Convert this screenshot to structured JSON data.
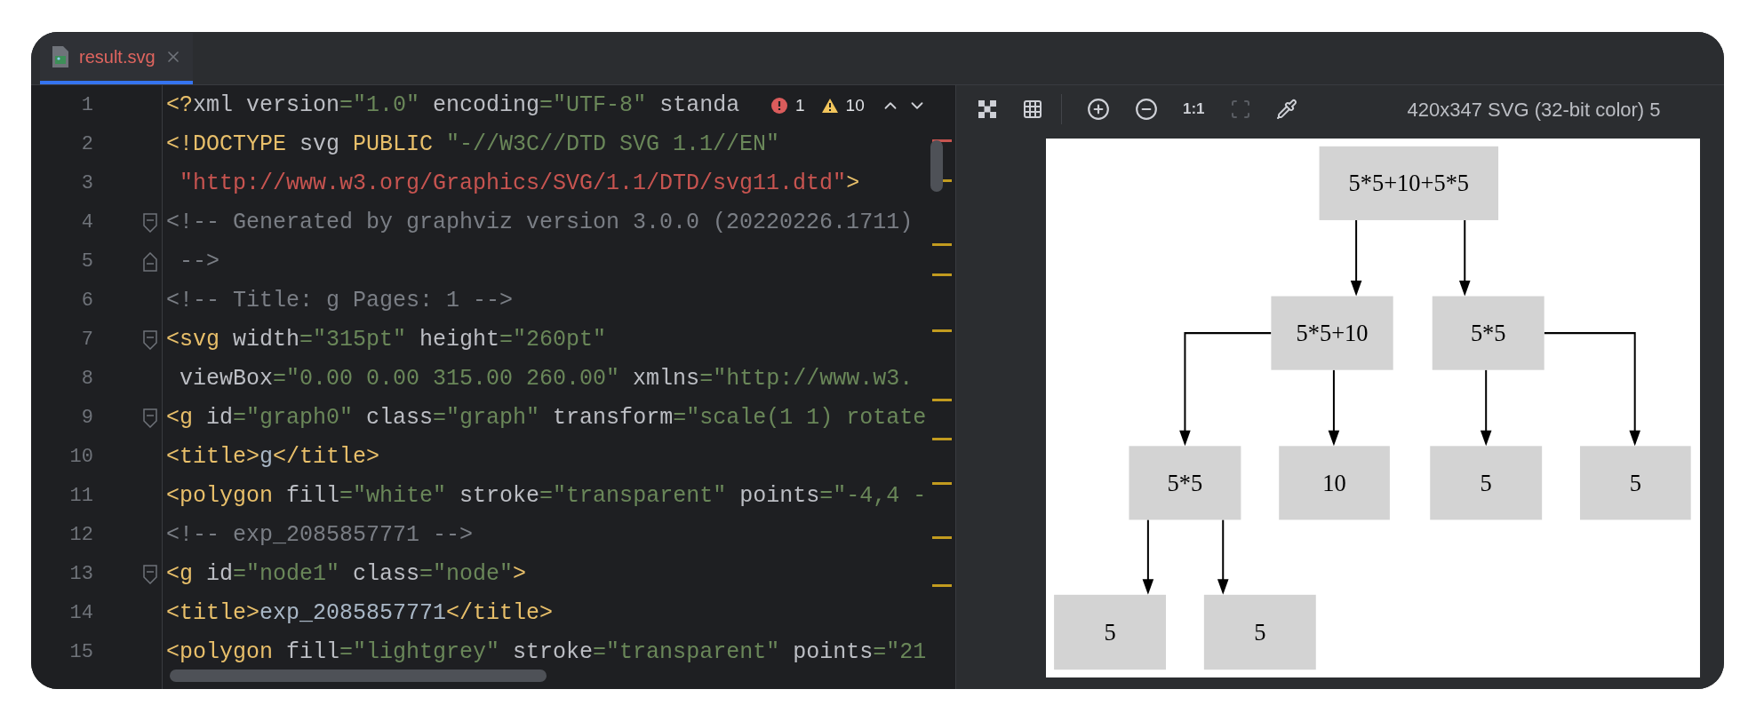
{
  "editor_tabs": [
    {
      "label": "result.svg",
      "selected": true,
      "has_errors": true
    }
  ],
  "code_lines": [
    {
      "number": "1",
      "tokens": [
        {
          "kind": "tag",
          "text": "<?"
        },
        {
          "kind": "plain",
          "text": "xml"
        },
        {
          "kind": "attr",
          "text": " version"
        },
        {
          "kind": "value",
          "text": "=\"1.0\""
        },
        {
          "kind": "attr",
          "text": " encoding"
        },
        {
          "kind": "value",
          "text": "=\"UTF-8\""
        },
        {
          "kind": "attr",
          "text": " standa"
        }
      ]
    },
    {
      "number": "2",
      "tokens": [
        {
          "kind": "tag",
          "text": "<!DOCTYPE"
        },
        {
          "kind": "plain",
          "text": " svg "
        },
        {
          "kind": "tag",
          "text": "PUBLIC"
        },
        {
          "kind": "value",
          "text": " \"-//W3C//DTD SVG 1.1//EN\""
        }
      ]
    },
    {
      "number": "3",
      "tokens": [
        {
          "kind": "url",
          "text": " \"http://www.w3.org/Graphics/SVG/1.1/DTD/svg11.dtd\""
        },
        {
          "kind": "tag",
          "text": ">"
        }
      ]
    },
    {
      "number": "4",
      "fold_start": true,
      "tokens": [
        {
          "kind": "comment",
          "text": "<!-- Generated by graphviz version 3.0.0 (20220226.1711)"
        }
      ]
    },
    {
      "number": "5",
      "fold_end": true,
      "tokens": [
        {
          "kind": "comment",
          "text": " -->"
        }
      ]
    },
    {
      "number": "6",
      "tokens": [
        {
          "kind": "comment",
          "text": "<!-- Title: g Pages: 1 -->"
        }
      ]
    },
    {
      "number": "7",
      "fold_start": true,
      "tokens": [
        {
          "kind": "tag",
          "text": "<svg"
        },
        {
          "kind": "attr",
          "text": " width"
        },
        {
          "kind": "value",
          "text": "=\"315pt\""
        },
        {
          "kind": "attr",
          "text": " height"
        },
        {
          "kind": "value",
          "text": "=\"260pt\""
        }
      ]
    },
    {
      "number": "8",
      "tokens": [
        {
          "kind": "attr",
          "text": " viewBox"
        },
        {
          "kind": "value",
          "text": "=\"0.00 0.00 315.00 260.00\""
        },
        {
          "kind": "attr",
          "text": " xmlns"
        },
        {
          "kind": "value",
          "text": "=\"http://www.w3."
        }
      ]
    },
    {
      "number": "9",
      "fold_start": true,
      "tokens": [
        {
          "kind": "tag",
          "text": "<g"
        },
        {
          "kind": "attr",
          "text": " id"
        },
        {
          "kind": "value",
          "text": "=\"graph0\""
        },
        {
          "kind": "attr",
          "text": " class"
        },
        {
          "kind": "value",
          "text": "=\"graph\""
        },
        {
          "kind": "attr",
          "text": " transform"
        },
        {
          "kind": "value",
          "text": "=\"scale(1 1) rotate"
        }
      ]
    },
    {
      "number": "10",
      "tokens": [
        {
          "kind": "tag",
          "text": "<title>"
        },
        {
          "kind": "text",
          "text": "g"
        },
        {
          "kind": "tag",
          "text": "</title>"
        }
      ]
    },
    {
      "number": "11",
      "tokens": [
        {
          "kind": "tag",
          "text": "<polygon"
        },
        {
          "kind": "attr",
          "text": " fill"
        },
        {
          "kind": "value",
          "text": "=\"white\""
        },
        {
          "kind": "attr",
          "text": " stroke"
        },
        {
          "kind": "value",
          "text": "=\"transparent\""
        },
        {
          "kind": "attr",
          "text": " points"
        },
        {
          "kind": "value",
          "text": "=\"-4,4 -"
        }
      ]
    },
    {
      "number": "12",
      "tokens": [
        {
          "kind": "comment",
          "text": "<!-- exp_2085857771 -->"
        }
      ]
    },
    {
      "number": "13",
      "fold_start": true,
      "tokens": [
        {
          "kind": "tag",
          "text": "<g"
        },
        {
          "kind": "attr",
          "text": " id"
        },
        {
          "kind": "value",
          "text": "=\"node1\""
        },
        {
          "kind": "attr",
          "text": " class"
        },
        {
          "kind": "value",
          "text": "=\"node\""
        },
        {
          "kind": "tag",
          "text": ">"
        }
      ]
    },
    {
      "number": "14",
      "tokens": [
        {
          "kind": "tag",
          "text": "<title>"
        },
        {
          "kind": "text",
          "text": "exp_2085857771"
        },
        {
          "kind": "tag",
          "text": "</title>"
        }
      ]
    },
    {
      "number": "15",
      "tokens": [
        {
          "kind": "tag",
          "text": "<polygon"
        },
        {
          "kind": "attr",
          "text": " fill"
        },
        {
          "kind": "value",
          "text": "=\"lightgrey\""
        },
        {
          "kind": "attr",
          "text": " stroke"
        },
        {
          "kind": "value",
          "text": "=\"transparent\""
        },
        {
          "kind": "attr",
          "text": " points"
        },
        {
          "kind": "value",
          "text": "=\"21"
        }
      ]
    }
  ],
  "inspections": {
    "errors": "1",
    "warnings": "10"
  },
  "preview_toolbar": [
    {
      "kind": "fit",
      "disabled": false
    },
    {
      "kind": "grid",
      "disabled": false
    },
    {
      "kind": "zoom_in",
      "disabled": false
    },
    {
      "kind": "zoom_out",
      "disabled": false
    },
    {
      "kind": "actual_size",
      "label": "1:1",
      "disabled": false
    },
    {
      "kind": "frame",
      "disabled": true
    },
    {
      "kind": "color_picker",
      "disabled": false
    }
  ],
  "preview_info": "420x347 SVG (32-bit color) 5",
  "tree": {
    "label": "5*5+10+5*5",
    "children": [
      {
        "label": "5*5+10",
        "children": [
          {
            "label": "5*5",
            "children": [
              {
                "label": "5"
              },
              {
                "label": "5"
              }
            ]
          },
          {
            "label": "10"
          }
        ]
      },
      {
        "label": "5*5",
        "children": [
          {
            "label": "5"
          },
          {
            "label": "5"
          }
        ]
      }
    ]
  }
}
